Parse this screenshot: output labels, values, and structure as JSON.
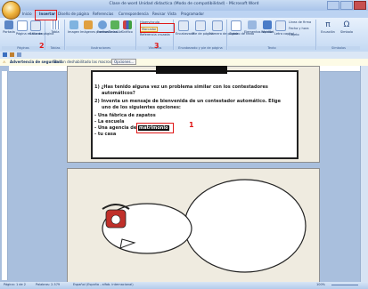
{
  "window": {
    "title": "Clase de word Unidad didactica (Modo de compatibilidad) - Microsoft Word"
  },
  "tabs": [
    "Inicio",
    "Insertar",
    "Diseño de página",
    "Referencias",
    "Correspondencia",
    "Revisar",
    "Vista",
    "Programador"
  ],
  "ribbon": {
    "groups": [
      "Páginas",
      "Tablas",
      "Ilustraciones",
      "Vínculos",
      "Encabezado y pie de página",
      "Texto",
      "Símbolos"
    ],
    "buttons": [
      "Portada",
      "Página en blanco",
      "Salto de página",
      "Tabla",
      "Imagen",
      "Imágenes prediseñadas",
      "Formas",
      "SmartArt",
      "Gráfico",
      "Hipervínculo",
      "Marcador",
      "Referencia cruzada",
      "Encabezado",
      "Pie de página",
      "Número de página",
      "Cuadro de texto",
      "Elementos rápidos",
      "WordArt",
      "Letra capital",
      "Línea de firma",
      "Fecha y hora",
      "Objeto",
      "Ecuación",
      "Símbolo"
    ],
    "highlight_label": "Marcador"
  },
  "security": {
    "label": "Advertencia de seguridad",
    "message": "Se han deshabilitado las macros.",
    "button": "Opciones..."
  },
  "document": {
    "lines": [
      "1) ¿Has tenido alguna vez un problema similar con los contestadores",
      "automáticos?",
      "2) Inventa un mensaje de bienvenida de un contestador automático. Elige",
      "uno de los siguientes opciones:",
      "- Una fábrica de zapatos",
      "- La escuela",
      "- Una agencia de",
      "- tu casa"
    ],
    "selected_word": "matrimonio"
  },
  "annotations": [
    "1",
    "2",
    "3"
  ],
  "status": {
    "page": "Página: 1 de 2",
    "words": "Palabras: 2.579",
    "language": "Español (España - alfab. internacional)",
    "zoom": "100%"
  },
  "colors": {
    "annotation": "#e01818",
    "ribbon": "#c4d9f3"
  }
}
